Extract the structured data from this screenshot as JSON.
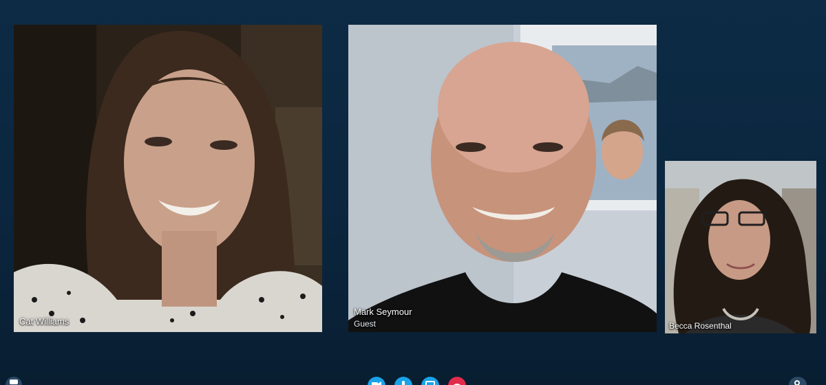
{
  "participants": [
    {
      "name": "Cat Williams",
      "role": ""
    },
    {
      "name": "Mark Seymour",
      "role": "Guest"
    },
    {
      "name": "Becca Rosenthal",
      "role": ""
    }
  ],
  "icons": {
    "video": "video-camera-icon",
    "mic": "microphone-icon",
    "screen": "screen-share-icon",
    "hangup": "end-call-icon",
    "chat": "chat-icon",
    "settings": "settings-icon"
  },
  "colors": {
    "background": "#0b2740",
    "accent": "#1aa3e8",
    "hangup": "#e32b4b"
  }
}
